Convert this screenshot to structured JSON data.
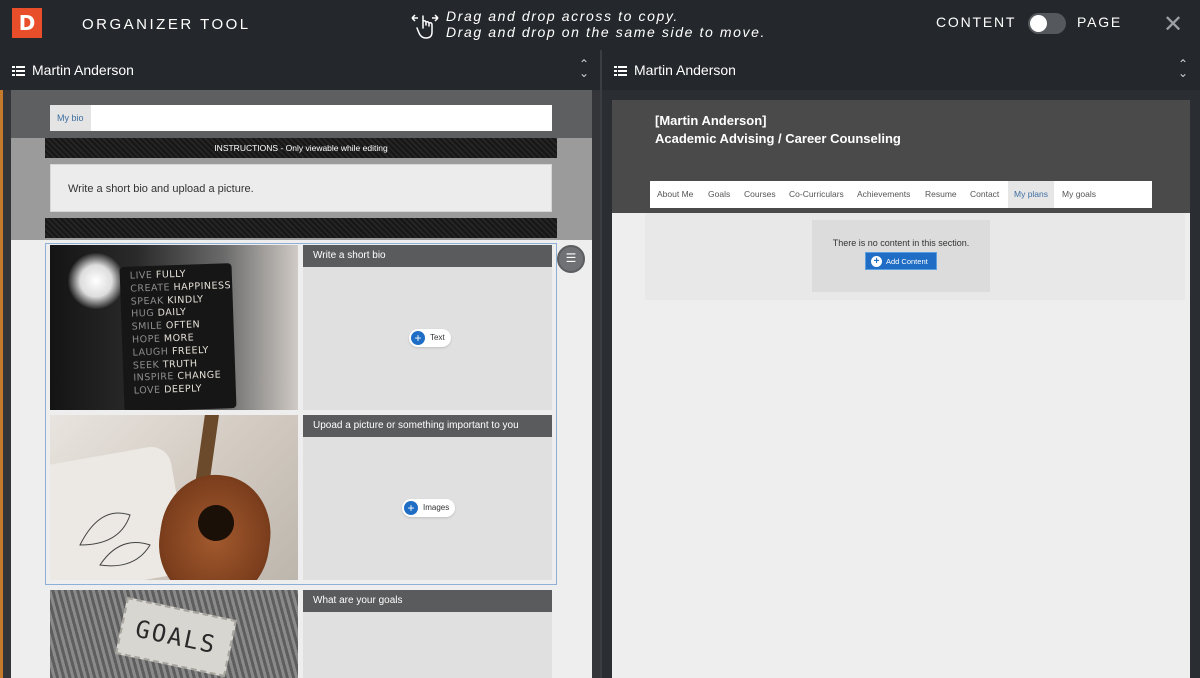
{
  "app": {
    "logo_letter": "D",
    "title": "ORGANIZER TOOL",
    "instruction_line1": "Drag and drop across to copy.",
    "instruction_line2": "Drag and drop on the same side to move.",
    "toggle_left": "CONTENT",
    "toggle_right": "PAGE",
    "close_glyph": "✕"
  },
  "left_panel": {
    "selector": "Martin Anderson",
    "tab": "My bio",
    "instructions_band": "INSTRUCTIONS - Only viewable while editing",
    "instructions_text": "Write a short bio and upload a picture.",
    "blocks": [
      {
        "heading": "Write a short bio",
        "add_label": "Text"
      },
      {
        "heading": "Upoad a picture or something important to you",
        "add_label": "Images"
      },
      {
        "heading": "What are your goals"
      }
    ],
    "poster_lines": [
      [
        "LIVE",
        "FULLY"
      ],
      [
        "CREATE",
        "HAPPINESS"
      ],
      [
        "SPEAK",
        "KINDLY"
      ],
      [
        "HUG",
        "DAILY"
      ],
      [
        "SMILE",
        "OFTEN"
      ],
      [
        "HOPE",
        "MORE"
      ],
      [
        "LAUGH",
        "FREELY"
      ],
      [
        "SEEK",
        "TRUTH"
      ],
      [
        "INSPIRE",
        "CHANGE"
      ],
      [
        "LOVE",
        "DEEPLY"
      ]
    ],
    "goals_tag": "GOALS"
  },
  "right_panel": {
    "selector": "Martin Anderson",
    "name_line": "[Martin Anderson]",
    "subtitle": "Academic Advising / Career Counseling",
    "nav": [
      "About Me",
      "Goals",
      "Courses",
      "Co-Curriculars",
      "Achievements",
      "Resume",
      "Contact",
      "My plans",
      "My goals"
    ],
    "active_nav": "My plans",
    "empty_text": "There is no content in this section.",
    "add_button": "Add Content"
  },
  "colors": {
    "logo": "#e94e2a",
    "accent_blue": "#1f6dc4",
    "topbar": "#24272b"
  },
  "icons": [
    "hand-drag-icon",
    "list-icon",
    "sort-arrows-icon",
    "close-icon",
    "plus-icon",
    "menu-icon"
  ]
}
